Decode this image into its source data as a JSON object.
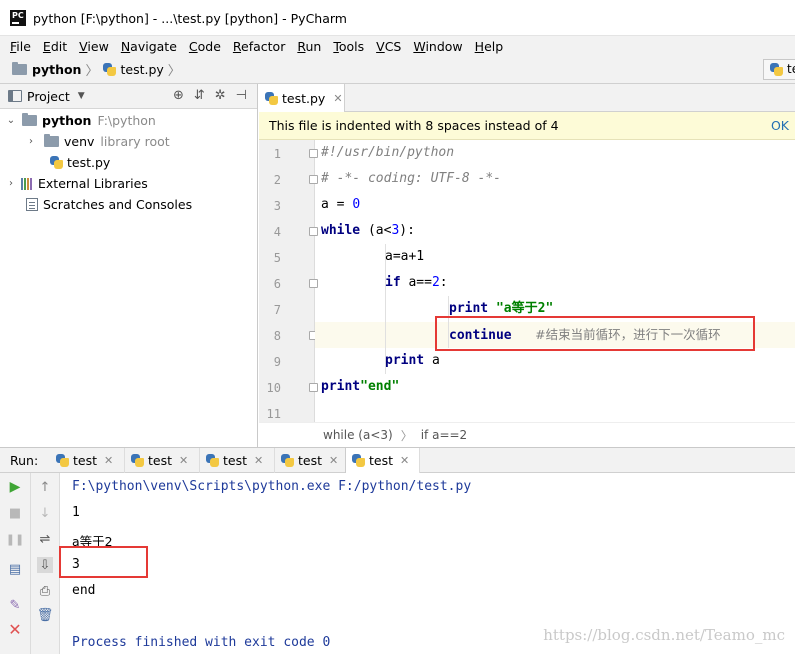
{
  "window": {
    "title": "python [F:\\python] - ...\\test.py [python] - PyCharm",
    "app_icon": "PC"
  },
  "menu": [
    "File",
    "Edit",
    "View",
    "Navigate",
    "Code",
    "Refactor",
    "Run",
    "Tools",
    "VCS",
    "Window",
    "Help"
  ],
  "navbar": {
    "project": "python",
    "file": "test.py",
    "right_tab": "tes"
  },
  "project_panel": {
    "title": "Project",
    "tree": {
      "root": {
        "name": "python",
        "path": "F:\\python"
      },
      "venv": {
        "name": "venv",
        "note": "library root"
      },
      "file": "test.py",
      "external": "External Libraries",
      "scratches": "Scratches and Consoles"
    }
  },
  "editor": {
    "tab": "test.py",
    "notice": "This file is indented with 8 spaces instead of 4",
    "notice_action": "OK",
    "line_numbers": [
      "1",
      "2",
      "3",
      "4",
      "5",
      "6",
      "7",
      "8",
      "9",
      "10",
      "11"
    ],
    "code": {
      "l1": "#!/usr/bin/python",
      "l2": "# -*- coding: UTF-8 -*-",
      "l3_var": "a = ",
      "l3_num": "0",
      "l4_kw": "while",
      "l4_a": " (a<",
      "l4_num": "3",
      "l4_b": "):",
      "l5": "a=a+1",
      "l6_kw": "if",
      "l6_a": " a==",
      "l6_num": "2",
      "l6_b": ":",
      "l7_kw": "print",
      "l7_str": " \"a等于2\"",
      "l8_kw": "continue",
      "l8_comment": "#结束当前循环，进行下一次循环",
      "l9_kw": "print",
      "l9_a": " a",
      "l10_kw": "print",
      "l10_str": "\"end\""
    },
    "breadcrumb": [
      "while (a<3)",
      "if a==2"
    ]
  },
  "run": {
    "label": "Run:",
    "tabs": [
      "test",
      "test",
      "test",
      "test",
      "test"
    ],
    "output": {
      "cmd": "F:\\python\\venv\\Scripts\\python.exe F:/python/test.py",
      "o1": "1",
      "o2": "a等于2",
      "o3": "3",
      "o4": "end",
      "exit": "Process finished with exit code 0"
    }
  },
  "watermark": "https://blog.csdn.net/Teamo_mc",
  "colors": {
    "highlight_box": "#e53935",
    "keyword": "#000080",
    "string": "#008000",
    "number": "#0000ff",
    "run_green": "#3fa535"
  }
}
